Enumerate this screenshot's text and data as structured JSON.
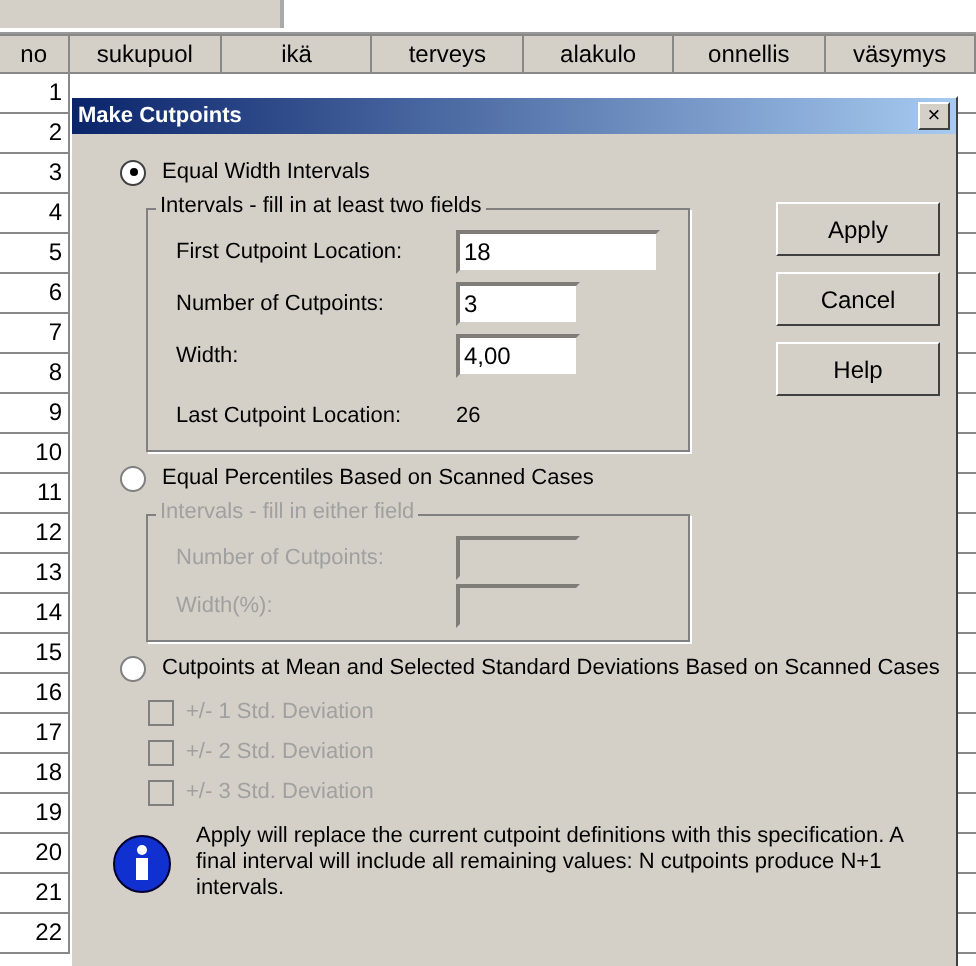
{
  "sheet": {
    "columns": [
      "no",
      "sukupuol",
      "ikä",
      "terveys",
      "alakulo",
      "onnellis",
      "väsymys"
    ],
    "row_numbers": [
      "1",
      "2",
      "3",
      "4",
      "5",
      "6",
      "7",
      "8",
      "9",
      "10",
      "11",
      "12",
      "13",
      "14",
      "15",
      "16",
      "17",
      "18",
      "19",
      "20",
      "21",
      "22"
    ]
  },
  "dialog": {
    "title": "Make Cutpoints",
    "close": "×",
    "options": [
      {
        "kind": "equal_width",
        "label": "Equal Width Intervals",
        "selected": true,
        "disabled": false,
        "group": {
          "title": "Intervals - fill in at least two fields",
          "fields": [
            {
              "label": "First Cutpoint Location:",
              "value": "18",
              "wide": true
            },
            {
              "label": "Number of Cutpoints:",
              "value": "3",
              "wide": false
            },
            {
              "label": "Width:",
              "value": "4,00",
              "wide": false
            }
          ],
          "result": {
            "label": "Last Cutpoint Location:",
            "value": "26"
          }
        }
      },
      {
        "kind": "percentiles",
        "label": "Equal Percentiles Based on Scanned Cases",
        "selected": false,
        "disabled": true,
        "group": {
          "title": "Intervals - fill in either field",
          "fields": [
            {
              "label": "Number of Cutpoints:",
              "wide": false
            },
            {
              "label": "Width(%):",
              "wide": false
            }
          ]
        }
      },
      {
        "kind": "std_dev",
        "label": "Cutpoints at Mean and Selected Standard Deviations Based on Scanned Cases",
        "selected": false,
        "disabled": true,
        "checks": [
          {
            "label": "+/- 1 Std. Deviation",
            "checked": false
          },
          {
            "label": "+/- 2 Std. Deviation",
            "checked": false
          },
          {
            "label": "+/- 3 Std. Deviation",
            "checked": false
          }
        ]
      }
    ],
    "buttons": [
      "Apply",
      "Cancel",
      "Help"
    ],
    "info": "Apply will replace the current cutpoint definitions with this specification. A final interval will include all remaining values: N cutpoints produce N+1 intervals."
  }
}
